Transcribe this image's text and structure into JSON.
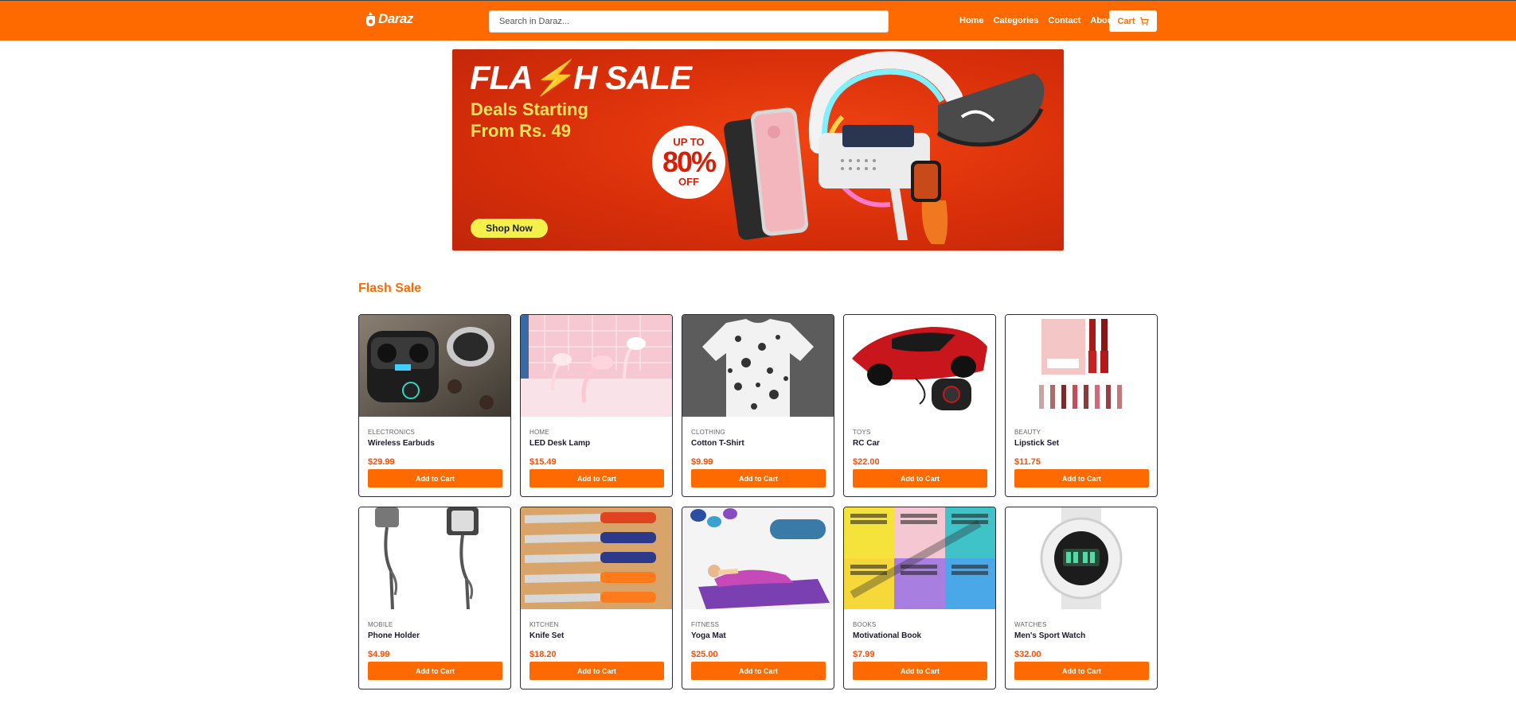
{
  "brand": {
    "name": "Daraz"
  },
  "search": {
    "placeholder": "Search in Daraz..."
  },
  "nav": {
    "links": [
      "Home",
      "Categories",
      "Contact",
      "About"
    ],
    "cart_label": "Cart"
  },
  "banner": {
    "title_left": "FLA",
    "title_right": "H SALE",
    "subtitle": "Deals Starting\nFrom Rs. 49",
    "badge_top": "UP TO",
    "badge_percent": "80%",
    "badge_bottom": "OFF",
    "cta": "Shop Now"
  },
  "section": {
    "title": "Flash Sale"
  },
  "products": [
    {
      "category": "ELECTRONICS",
      "name": "Wireless Earbuds",
      "price": "$29.99",
      "cta": "Add to Cart"
    },
    {
      "category": "HOME",
      "name": "LED Desk Lamp",
      "price": "$15.49",
      "cta": "Add to Cart"
    },
    {
      "category": "CLOTHING",
      "name": "Cotton T-Shirt",
      "price": "$9.99",
      "cta": "Add to Cart"
    },
    {
      "category": "TOYS",
      "name": "RC Car",
      "price": "$22.00",
      "cta": "Add to Cart"
    },
    {
      "category": "BEAUTY",
      "name": "Lipstick Set",
      "price": "$11.75",
      "cta": "Add to Cart"
    },
    {
      "category": "MOBILE",
      "name": "Phone Holder",
      "price": "$4.99",
      "cta": "Add to Cart"
    },
    {
      "category": "KITCHEN",
      "name": "Knife Set",
      "price": "$18.20",
      "cta": "Add to Cart"
    },
    {
      "category": "FITNESS",
      "name": "Yoga Mat",
      "price": "$25.00",
      "cta": "Add to Cart"
    },
    {
      "category": "BOOKS",
      "name": "Motivational Book",
      "price": "$7.99",
      "cta": "Add to Cart"
    },
    {
      "category": "WATCHES",
      "name": "Men's Sport Watch",
      "price": "$32.00",
      "cta": "Add to Cart"
    }
  ],
  "colors": {
    "accent": "#ff6a00",
    "price": "#ff4d00",
    "banner_bg": "#d92f0a",
    "cta_yellow": "#f5f04a"
  }
}
